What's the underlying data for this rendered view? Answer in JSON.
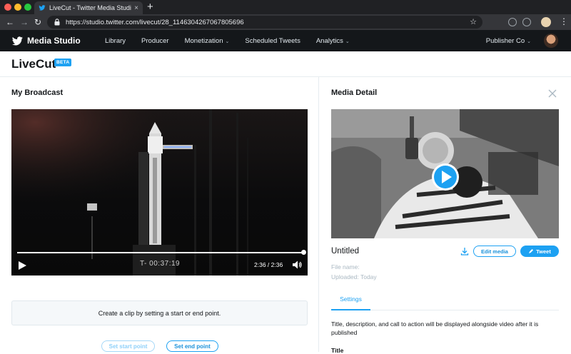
{
  "browser": {
    "tab_title": "LiveCut - Twitter Media Studio",
    "url": "https://studio.twitter.com/livecut/28_1146304267067805696"
  },
  "app": {
    "brand": "Media Studio",
    "nav": [
      "Library",
      "Producer",
      "Monetization",
      "Scheduled Tweets",
      "Analytics"
    ],
    "account": "Publisher Co"
  },
  "page": {
    "title": "LiveCut",
    "badge": "BETA"
  },
  "broadcast": {
    "heading": "My Broadcast",
    "timecode": "T- 00:37:19",
    "time": "2:36 / 2:36",
    "progress": 1.0,
    "clip_hint": "Create a clip by setting a start or end point.",
    "set_start": "Set start point",
    "set_end": "Set end point"
  },
  "media": {
    "heading": "Media Detail",
    "name": "Untitled",
    "edit_label": "Edit media",
    "tweet_label": "Tweet",
    "file_name": "File name:",
    "uploaded": "Uploaded: Today",
    "tab": "Settings",
    "description": "Title, description, and call to action will be displayed alongside video after it is published",
    "field_title": "Title"
  },
  "colors": {
    "accent": "#1da1f2",
    "appbar": "#14171a"
  }
}
